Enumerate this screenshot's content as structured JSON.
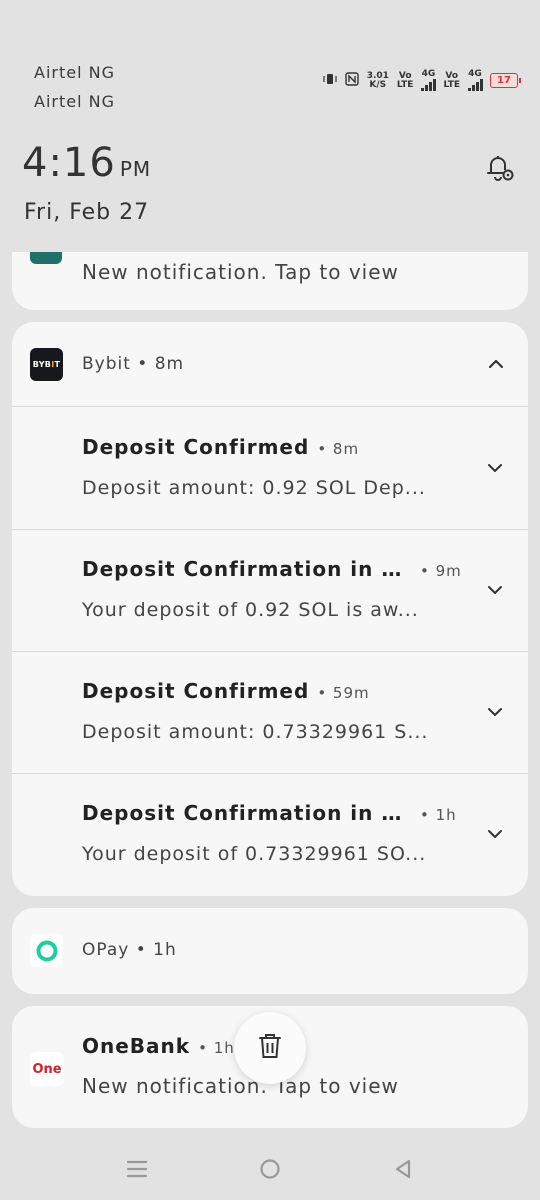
{
  "status_bar": {
    "carrier_1": "Airtel NG",
    "carrier_2": "Airtel NG",
    "speed_value": "3.01",
    "speed_unit": "K/S",
    "volte_label_1": "Vo",
    "volte_sub_1": "LTE",
    "net_1": "4G",
    "volte_label_2": "Vo",
    "volte_sub_2": "LTE",
    "net_2": "4G",
    "battery_level": "17",
    "battery_fraction": 0.17,
    "battery_color": "#d33333"
  },
  "clock": {
    "time": "4:16",
    "ampm": "PM",
    "date": "Fri, Feb 27"
  },
  "notifications": {
    "top_partial": {
      "text": "New notification. Tap to view",
      "icon": "app-icon",
      "icon_color": "#1f6f6b"
    },
    "bybit": {
      "logo_text_1": "BYB",
      "logo_text_2": "I",
      "logo_text_3": "T",
      "app_name": "Bybit • 8m",
      "items": [
        {
          "title": "Deposit Confirmed",
          "time": "• 8m",
          "body": "Deposit amount: 0.92 SOL Dep..."
        },
        {
          "title": "Deposit Confirmation in Pr...",
          "time": "• 9m",
          "body": "Your deposit of 0.92 SOL is aw..."
        },
        {
          "title": "Deposit Confirmed",
          "time": "• 59m",
          "body": "Deposit amount: 0.73329961 S..."
        },
        {
          "title": "Deposit Confirmation in Pro...",
          "time": "• 1h",
          "body": "Your deposit of 0.73329961 SO..."
        }
      ]
    },
    "opay": {
      "app_name": "OPay • 1h",
      "brand_color": "#1dcf9f"
    },
    "onebank": {
      "logo_text": "One",
      "title": "OneBank",
      "time": "• 1h",
      "body": "New notification. Tap to view",
      "brand_color": "#d81f26"
    }
  },
  "icons": {
    "clear_all": "trash-icon",
    "settings": "bell-settings-icon",
    "nav": [
      "menu-icon",
      "home-icon",
      "back-icon"
    ]
  },
  "colors": {
    "background": "#e2e2e2",
    "card": "#f7f7f7"
  }
}
